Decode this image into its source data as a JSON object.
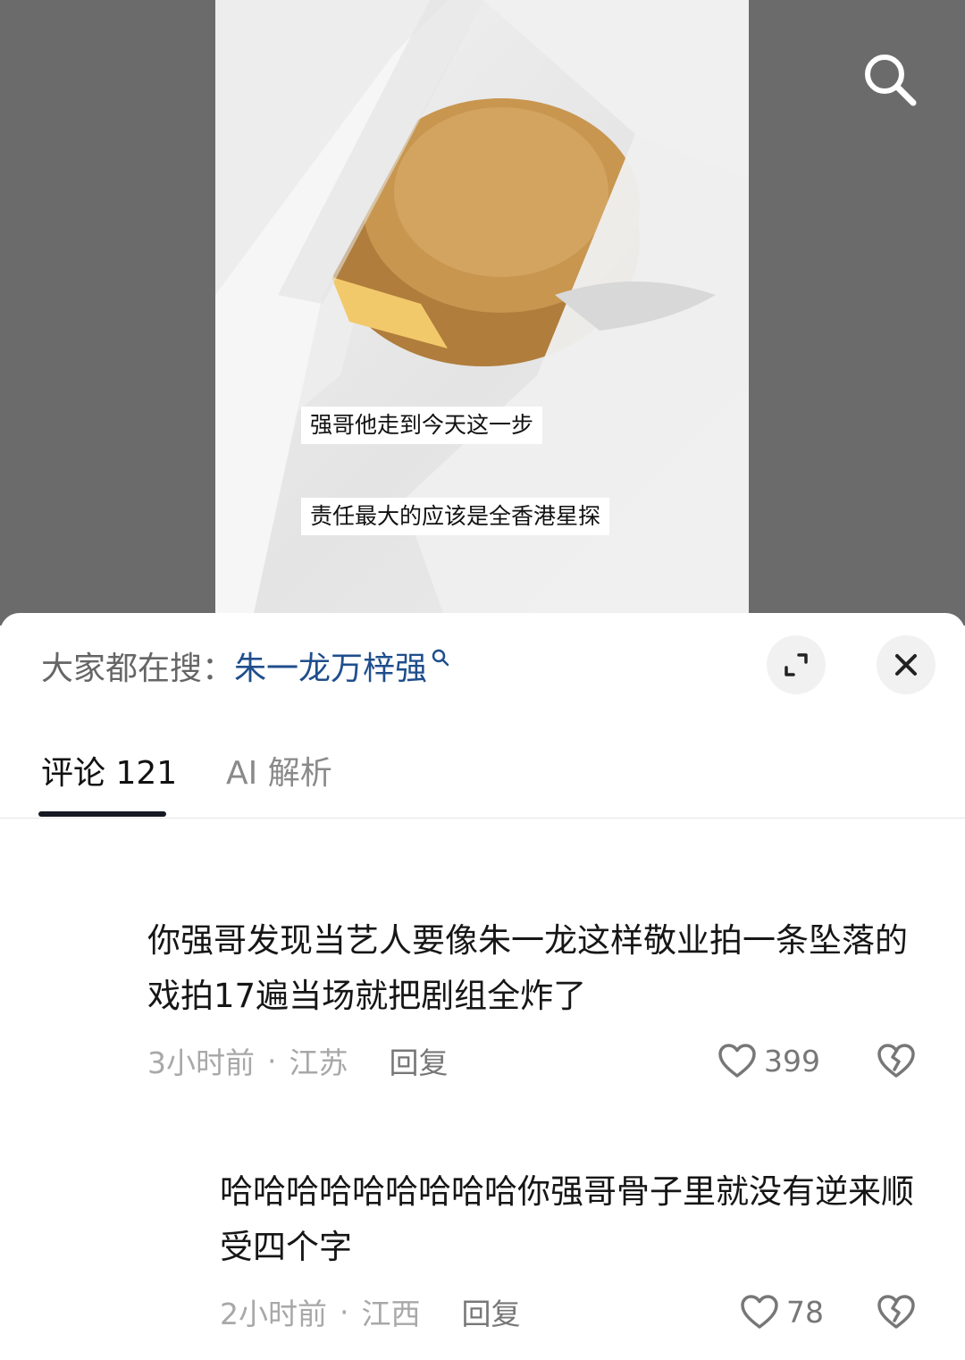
{
  "video": {
    "subtitles": [
      "强哥他走到今天这一步",
      "责任最大的应该是全香港星探"
    ]
  },
  "trending": {
    "prefix": "大家都在搜：",
    "term": "朱一龙万梓强"
  },
  "tabs": [
    {
      "label": "评论 121",
      "active": true
    },
    {
      "label": "AI 解析",
      "active": false
    }
  ],
  "comments": [
    {
      "text": "你强哥发现当艺人要像朱一龙这样敬业拍一条坠落的戏拍17遍当场就把剧组全炸了",
      "time": "3小时前",
      "location": "江苏",
      "reply_label": "回复",
      "likes": "399"
    },
    {
      "text": "哈哈哈哈哈哈哈哈哈你强哥骨子里就没有逆来顺受四个字",
      "time": "2小时前",
      "location": "江西",
      "reply_label": "回复",
      "likes": "78"
    }
  ],
  "colors": {
    "link": "#1f4e8c",
    "tab_indicator": "#161823"
  }
}
